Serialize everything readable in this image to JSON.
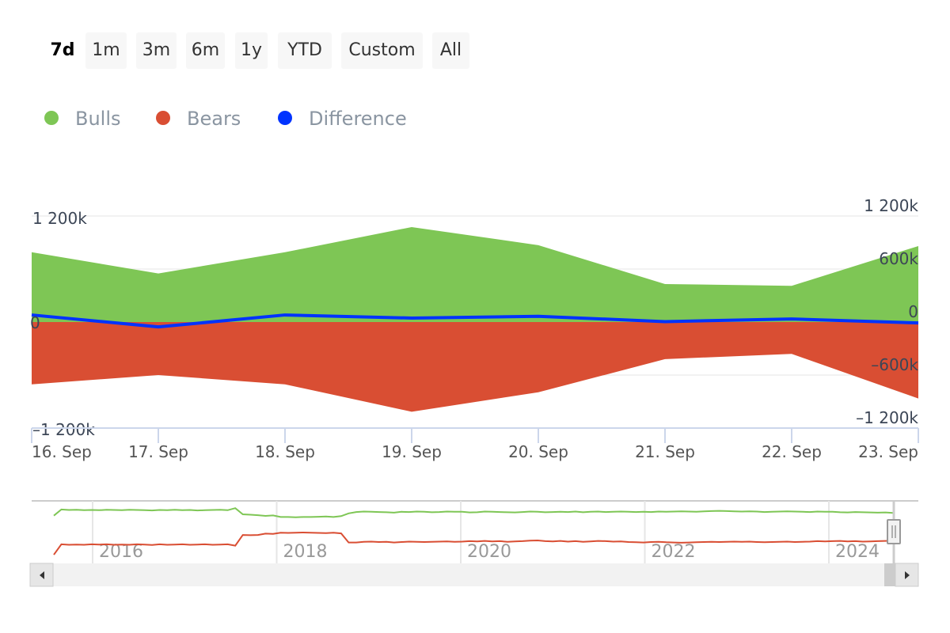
{
  "range_selector": {
    "buttons": [
      "7d",
      "1m",
      "3m",
      "6m",
      "1y",
      "YTD",
      "Custom",
      "All"
    ],
    "selected": "7d"
  },
  "legend": [
    {
      "name": "Bulls",
      "color": "#7ec655"
    },
    {
      "name": "Bears",
      "color": "#d94e33"
    },
    {
      "name": "Difference",
      "color": "#0033ff"
    }
  ],
  "chart_data": {
    "type": "area",
    "title": "",
    "xlabel": "",
    "ylabel": "",
    "categories": [
      "16. Sep",
      "17. Sep",
      "18. Sep",
      "19. Sep",
      "20. Sep",
      "21. Sep",
      "22. Sep",
      "23. Sep"
    ],
    "series": [
      {
        "name": "Bulls",
        "type": "area",
        "color": "#7ec655",
        "values": [
          790,
          550,
          790,
          1075,
          870,
          430,
          410,
          860
        ]
      },
      {
        "name": "Bears",
        "type": "area",
        "color": "#d94e33",
        "values": [
          -705,
          -600,
          -705,
          -1015,
          -795,
          -420,
          -360,
          -865
        ]
      },
      {
        "name": "Difference",
        "type": "line",
        "color": "#0033ff",
        "values": [
          80,
          -55,
          80,
          45,
          65,
          5,
          35,
          -10
        ]
      }
    ],
    "units": "k",
    "ylim": [
      -1200,
      1200
    ],
    "y_ticks_left": [
      "1 200k",
      "0",
      "-1 200k"
    ],
    "y_ticks_left_values": [
      1200,
      0,
      -1200
    ],
    "y_ticks_right": [
      "1 200k",
      "600k",
      "0",
      "-600k",
      "-1 200k"
    ],
    "y_ticks_right_values": [
      1200,
      600,
      0,
      -600,
      -1200
    ],
    "grid": true,
    "legend_position": "top-left",
    "navigator": {
      "x_labels": [
        "2016",
        "2018",
        "2020",
        "2022",
        "2024"
      ],
      "x_range": [
        2015.3,
        2024.7
      ],
      "bulls_samples": [
        620,
        890,
        870,
        880,
        860,
        870,
        860,
        880,
        870,
        860,
        880,
        870,
        860,
        850,
        870,
        860,
        880,
        860,
        870,
        850,
        860,
        870,
        880,
        860,
        950,
        680,
        660,
        640,
        610,
        630,
        560,
        560,
        550,
        560,
        560,
        570,
        580,
        560,
        600,
        720,
        780,
        800,
        790,
        780,
        770,
        750,
        790,
        780,
        800,
        790,
        770,
        780,
        800,
        790,
        790,
        760,
        770,
        800,
        790,
        780,
        770,
        760,
        780,
        800,
        790,
        770,
        780,
        790,
        780,
        800,
        770,
        790,
        800,
        780,
        790,
        800,
        790,
        780,
        790,
        780,
        800,
        790,
        800,
        810,
        800,
        790,
        810,
        820,
        830,
        820,
        810,
        800,
        810,
        800,
        780,
        790,
        800,
        810,
        800,
        790,
        780,
        800,
        790,
        790,
        770,
        760,
        780,
        770,
        760,
        750,
        760,
        740
      ],
      "bears_samples": [
        -1100,
        -640,
        -660,
        -650,
        -660,
        -640,
        -650,
        -640,
        -660,
        -650,
        -660,
        -640,
        -650,
        -670,
        -640,
        -660,
        -650,
        -640,
        -660,
        -650,
        -640,
        -660,
        -650,
        -640,
        -700,
        -230,
        -240,
        -230,
        -170,
        -180,
        -130,
        -140,
        -130,
        -120,
        -130,
        -140,
        -150,
        -130,
        -160,
        -560,
        -560,
        -530,
        -520,
        -540,
        -530,
        -560,
        -540,
        -520,
        -530,
        -540,
        -530,
        -520,
        -510,
        -530,
        -520,
        -500,
        -510,
        -490,
        -510,
        -500,
        -530,
        -510,
        -500,
        -480,
        -470,
        -500,
        -510,
        -490,
        -520,
        -500,
        -530,
        -510,
        -490,
        -500,
        -520,
        -510,
        -540,
        -550,
        -560,
        -540,
        -530,
        -550,
        -560,
        -570,
        -560,
        -550,
        -540,
        -530,
        -540,
        -530,
        -520,
        -530,
        -520,
        -540,
        -550,
        -540,
        -530,
        -520,
        -540,
        -530,
        -520,
        -500,
        -510,
        -500,
        -490,
        -510,
        -500,
        -520,
        -510,
        -500,
        -490,
        -480
      ]
    }
  }
}
